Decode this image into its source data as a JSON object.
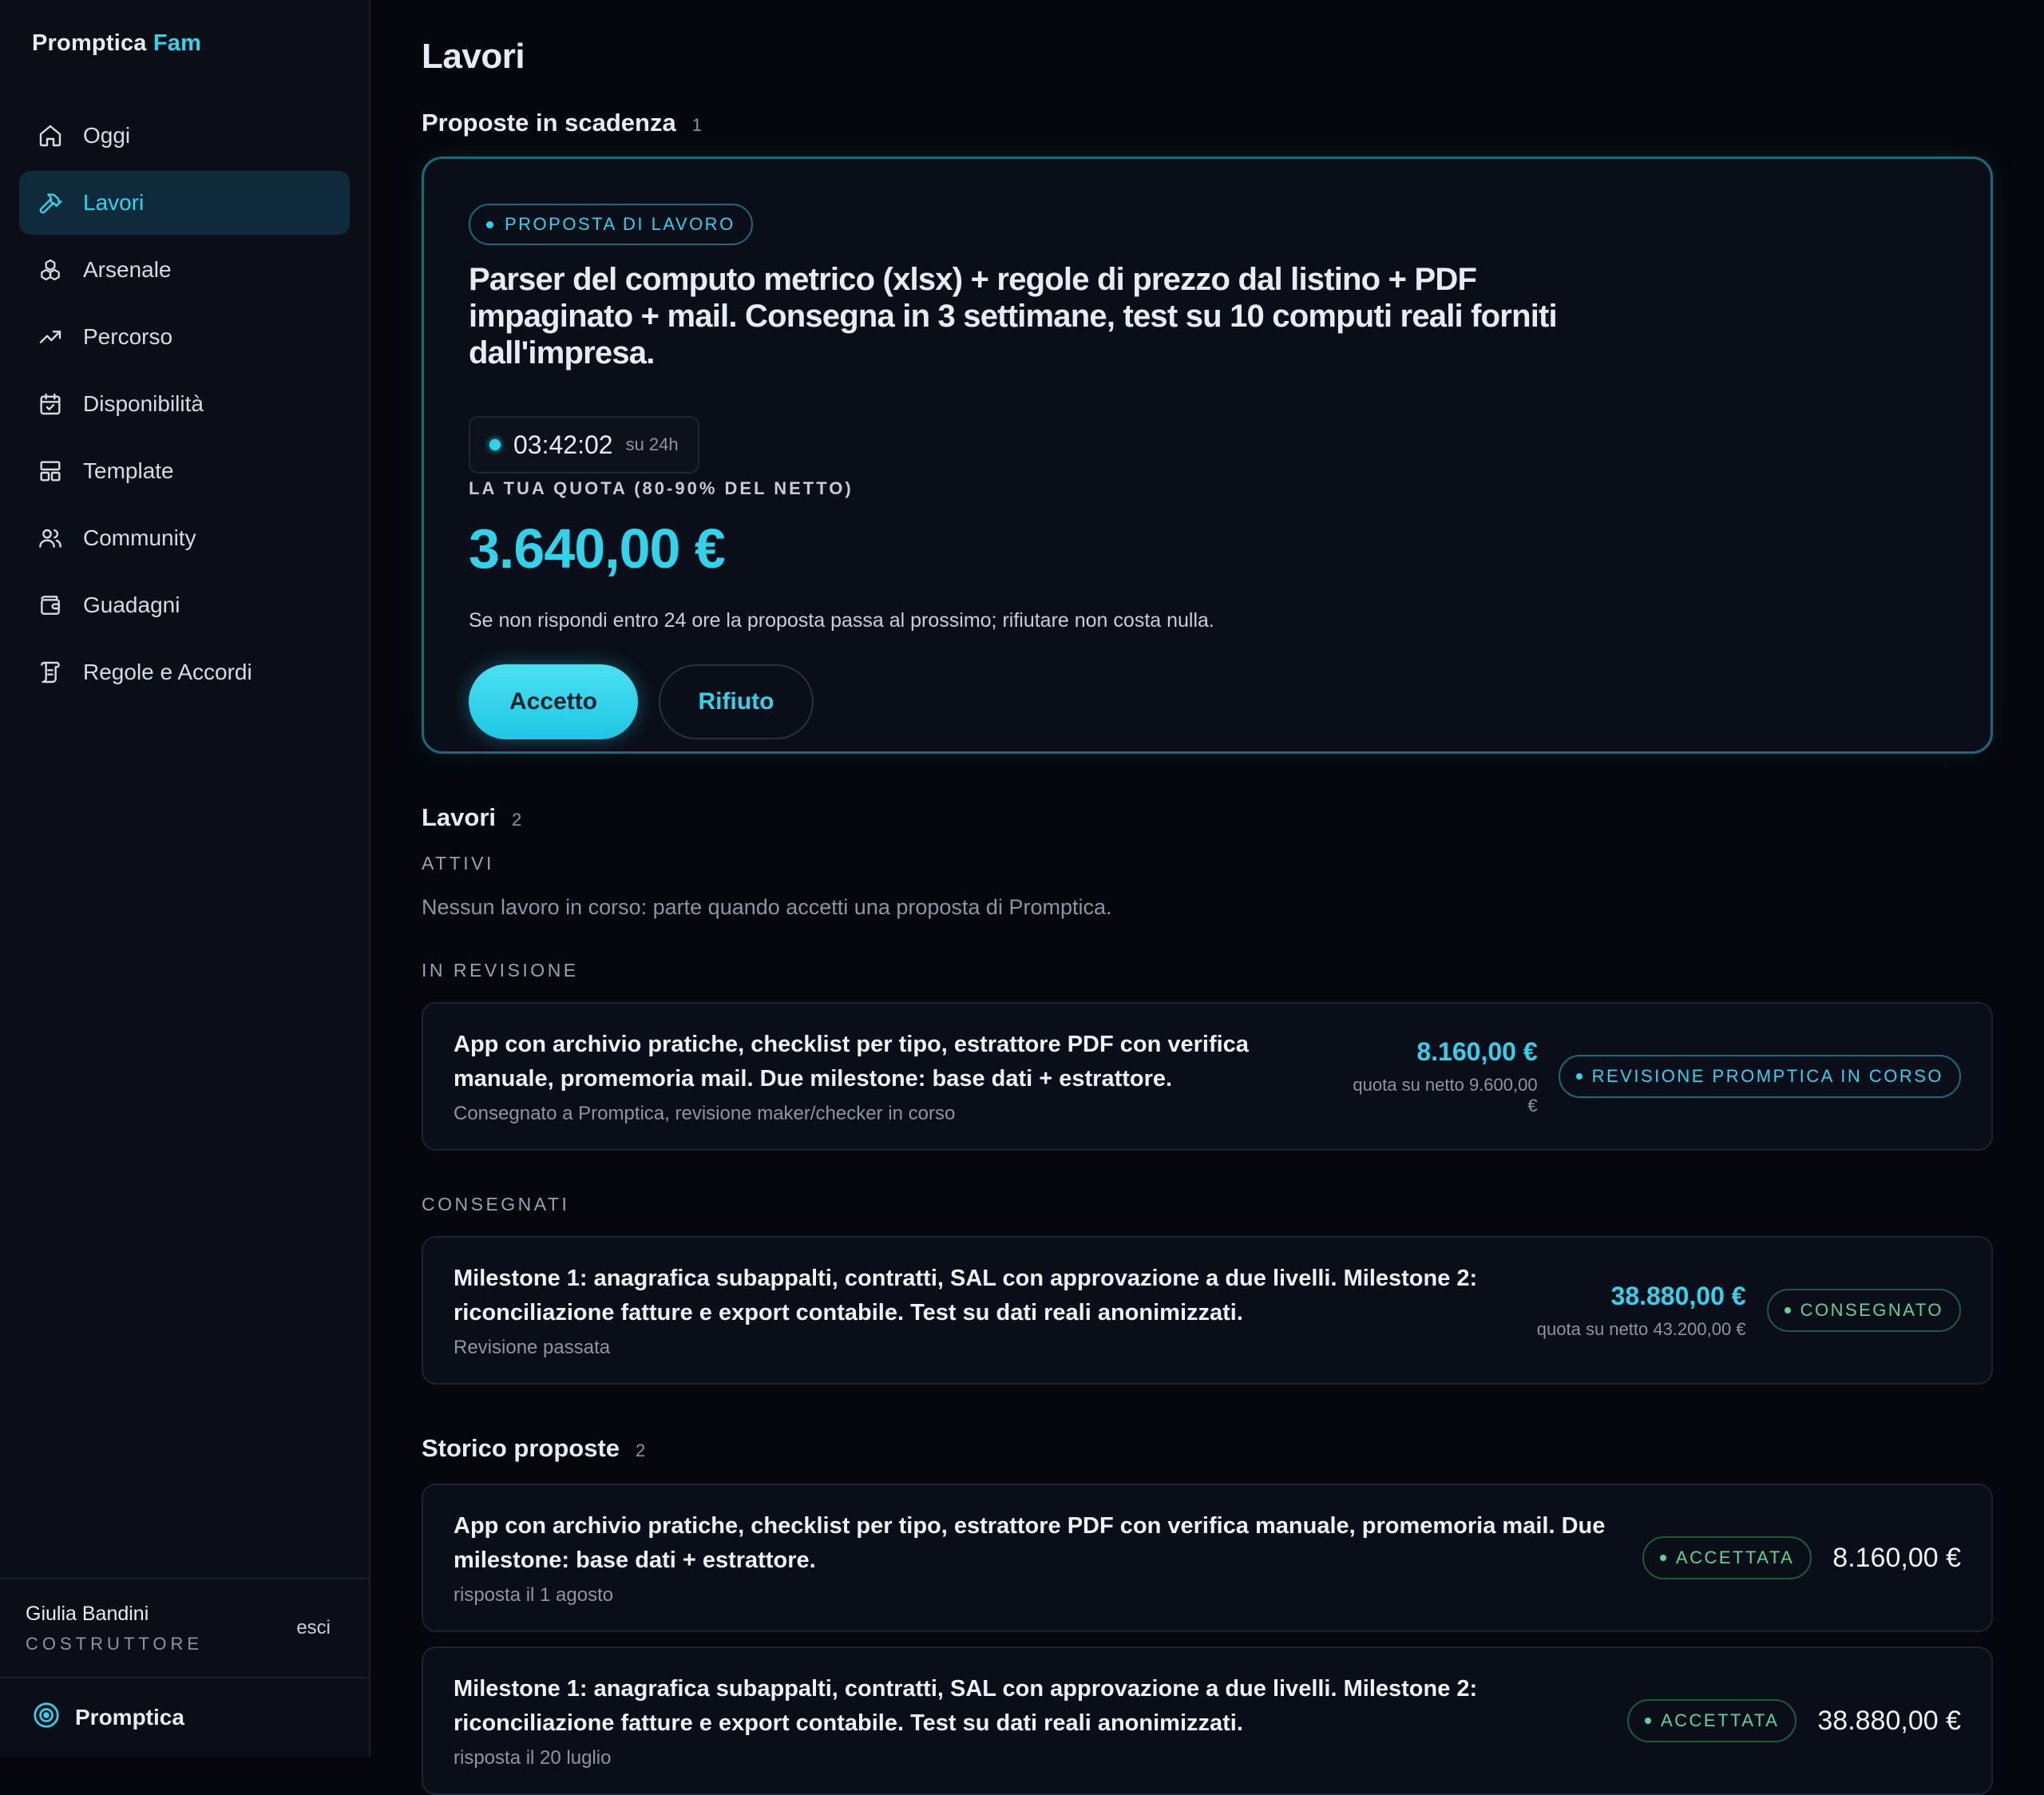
{
  "app": {
    "brand_main": "Promptica",
    "brand_accent": "Fam",
    "footer_brand": "Promptica"
  },
  "sidebar": {
    "items": [
      {
        "label": "Oggi",
        "icon": "home-icon",
        "active": false
      },
      {
        "label": "Lavori",
        "icon": "hammer-icon",
        "active": true
      },
      {
        "label": "Arsenale",
        "icon": "boxes-icon",
        "active": false
      },
      {
        "label": "Percorso",
        "icon": "trend-up-icon",
        "active": false
      },
      {
        "label": "Disponibilità",
        "icon": "calendar-icon",
        "active": false
      },
      {
        "label": "Template",
        "icon": "layout-icon",
        "active": false
      },
      {
        "label": "Community",
        "icon": "users-icon",
        "active": false
      },
      {
        "label": "Guadagni",
        "icon": "wallet-icon",
        "active": false
      },
      {
        "label": "Regole e Accordi",
        "icon": "scroll-icon",
        "active": false
      }
    ]
  },
  "user": {
    "name": "Giulia Bandini",
    "role": "COSTRUTTORE",
    "logout_label": "esci"
  },
  "page": {
    "title": "Lavori"
  },
  "proposals": {
    "title": "Proposte in scadenza",
    "count": "1",
    "card": {
      "chip_label": "PROPOSTA DI LAVORO",
      "text": "Parser del computo metrico (xlsx) + regole di prezzo dal listino + PDF impaginato + mail. Consegna in 3 settimane, test su 10 computi reali forniti dall'impresa.",
      "timer": "03:42:02",
      "timer_of": "su 24h",
      "quota_label": "LA TUA QUOTA (80-90% DEL NETTO)",
      "quota_value": "3.640,00 €",
      "notice": "Se non rispondi entro 24 ore la proposta passa al prossimo; rifiutare non costa nulla.",
      "accept_label": "Accetto",
      "reject_label": "Rifiuto"
    }
  },
  "jobs": {
    "title": "Lavori",
    "count": "2",
    "active": {
      "label": "ATTIVI",
      "empty": "Nessun lavoro in corso: parte quando accetti una proposta di Promptica."
    },
    "review": {
      "label": "IN REVISIONE",
      "items": [
        {
          "title": "App con archivio pratiche, checklist per tipo, estrattore PDF con verifica manuale, promemoria mail. Due milestone: base dati + estrattore.",
          "sub": "Consegnato a Promptica, revisione maker/checker in corso",
          "amount": "8.160,00 €",
          "amount_sub": "quota su netto 9.600,00 €",
          "badge": "REVISIONE PROMPTICA IN CORSO"
        }
      ]
    },
    "delivered": {
      "label": "CONSEGNATI",
      "items": [
        {
          "title": "Milestone 1: anagrafica subappalti, contratti, SAL con approvazione a due livelli. Milestone 2: riconciliazione fatture e export contabile. Test su dati reali anonimizzati.",
          "sub": "Revisione passata",
          "amount": "38.880,00 €",
          "amount_sub": "quota su netto 43.200,00 €",
          "badge": "CONSEGNATO"
        }
      ]
    }
  },
  "history": {
    "title": "Storico proposte",
    "count": "2",
    "items": [
      {
        "title": "App con archivio pratiche, checklist per tipo, estrattore PDF con verifica manuale, promemoria mail. Due milestone: base dati + estrattore.",
        "sub": "risposta il 1 agosto",
        "badge": "ACCETTATA",
        "amount": "8.160,00 €"
      },
      {
        "title": "Milestone 1: anagrafica subappalti, contratti, SAL con approvazione a due livelli. Milestone 2: riconciliazione fatture e export contabile. Test su dati reali anonimizzati.",
        "sub": "risposta il 20 luglio",
        "badge": "ACCETTATA",
        "amount": "38.880,00 €"
      }
    ]
  },
  "colors": {
    "accent": "#2fd3ec",
    "success": "#5fd394",
    "background": "#05070d",
    "sidebar": "#0b0e17"
  }
}
